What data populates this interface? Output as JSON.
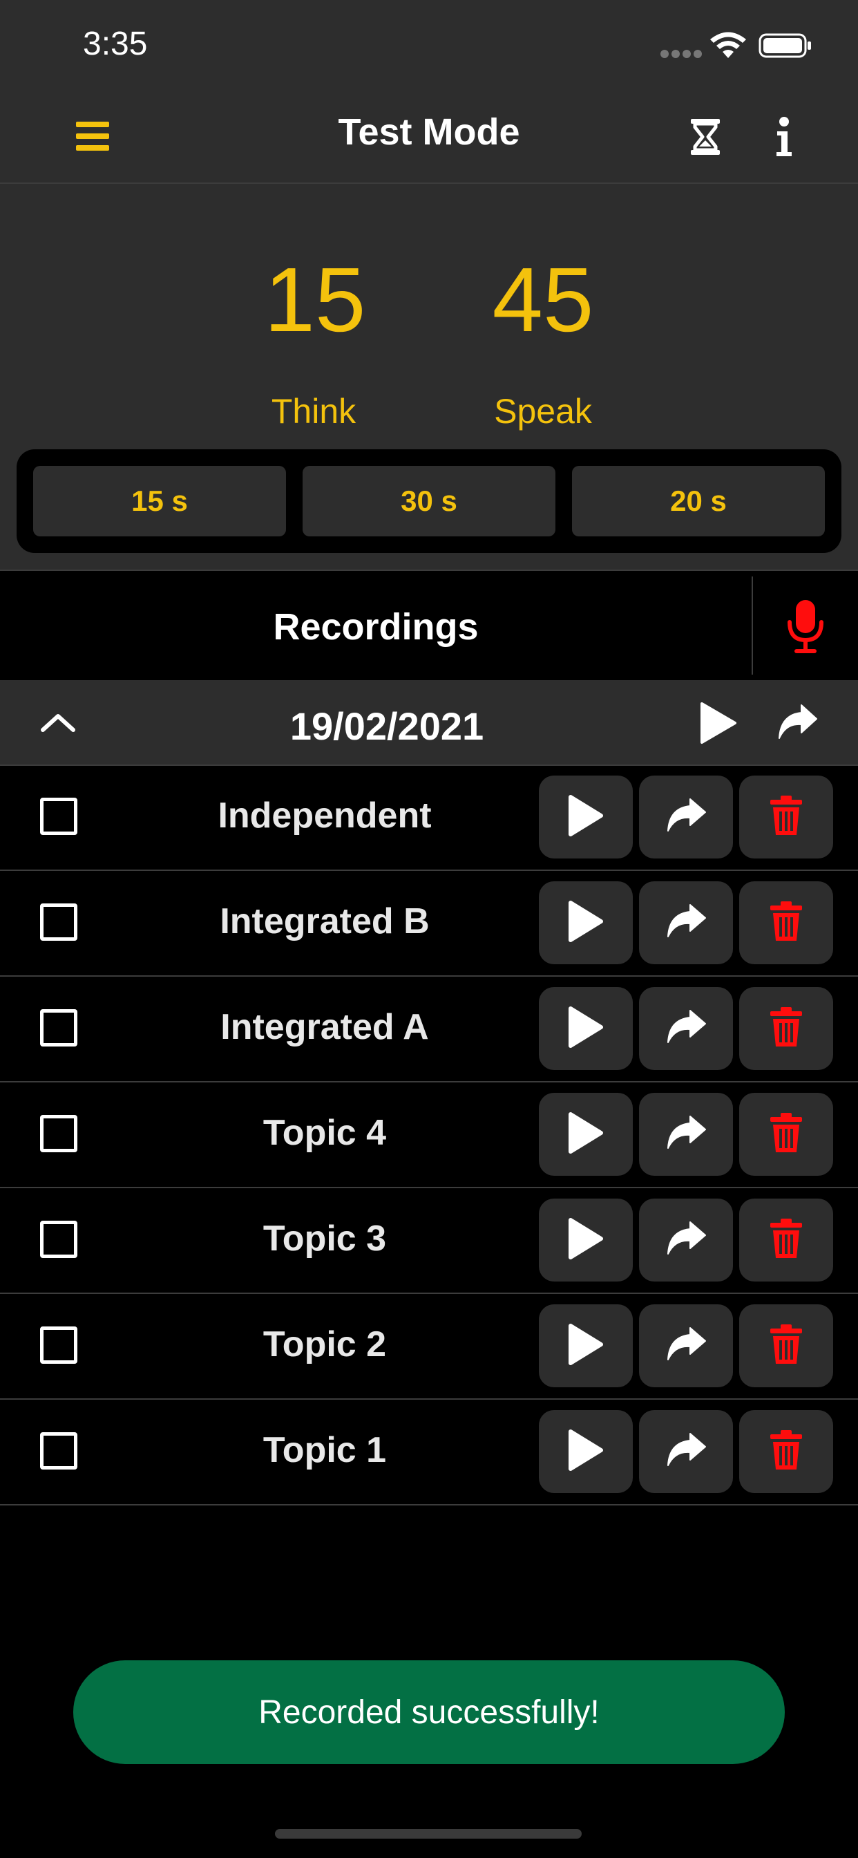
{
  "status_bar": {
    "time": "3:35"
  },
  "nav": {
    "title": "Test Mode"
  },
  "timer": {
    "think_value": "15",
    "speak_value": "45",
    "think_label": "Think",
    "speak_label": "Speak",
    "presets": [
      "15 s",
      "30 s",
      "20 s"
    ]
  },
  "recordings": {
    "title": "Recordings",
    "group_date": "19/02/2021",
    "items": [
      {
        "label": "Independent"
      },
      {
        "label": "Integrated B"
      },
      {
        "label": "Integrated A"
      },
      {
        "label": "Topic 4"
      },
      {
        "label": "Topic 3"
      },
      {
        "label": "Topic 2"
      },
      {
        "label": "Topic 1"
      }
    ]
  },
  "toast": {
    "message": "Recorded successfully!"
  },
  "colors": {
    "accent": "#f4c20d",
    "background": "#000000",
    "panel": "#2d2d2d",
    "danger": "#ff0d0d",
    "success": "#037044"
  },
  "icons": {
    "menu": "menu-icon",
    "timer": "hourglass-icon",
    "info": "info-icon",
    "record": "microphone-icon",
    "collapse": "chevron-up-icon",
    "play": "play-icon",
    "share": "share-icon",
    "delete": "trash-icon"
  }
}
